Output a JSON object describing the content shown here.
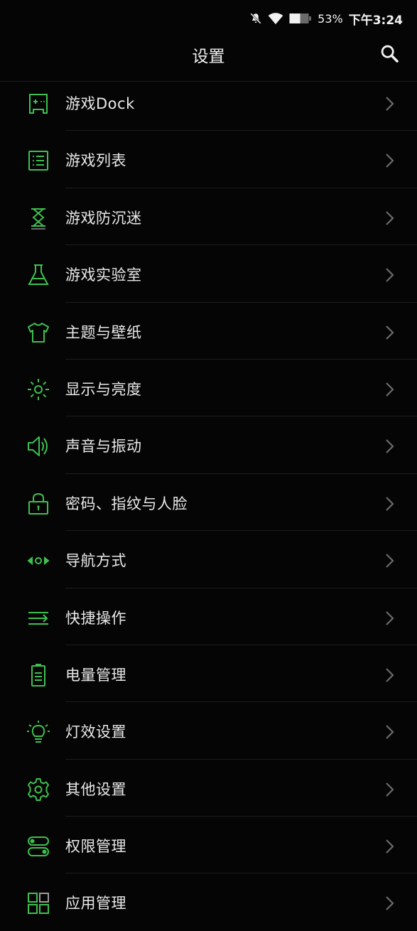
{
  "colors": {
    "accent": "#3fbf4f",
    "background": "#050505",
    "text": "#e9e9e9",
    "chevron": "#6b6b6b"
  },
  "status_bar": {
    "icons": [
      "bell-off-icon",
      "wifi-icon",
      "battery-icon"
    ],
    "battery_text": "53%",
    "time": "下午3:24"
  },
  "header": {
    "title": "设置",
    "search_icon": "search-icon"
  },
  "items": [
    {
      "label": "游戏Dock",
      "icon": "gamepad-icon"
    },
    {
      "label": "游戏列表",
      "icon": "list-icon"
    },
    {
      "label": "游戏防沉迷",
      "icon": "hourglass-icon"
    },
    {
      "label": "游戏实验室",
      "icon": "flask-icon"
    },
    {
      "label": "主题与壁纸",
      "icon": "shirt-icon"
    },
    {
      "label": "显示与亮度",
      "icon": "brightness-icon"
    },
    {
      "label": "声音与振动",
      "icon": "speaker-icon"
    },
    {
      "label": "密码、指纹与人脸",
      "icon": "lock-icon"
    },
    {
      "label": "导航方式",
      "icon": "navigation-icon"
    },
    {
      "label": "快捷操作",
      "icon": "shortcut-icon"
    },
    {
      "label": "电量管理",
      "icon": "battery-manage-icon"
    },
    {
      "label": "灯效设置",
      "icon": "bulb-icon"
    },
    {
      "label": "其他设置",
      "icon": "gear-icon"
    },
    {
      "label": "权限管理",
      "icon": "toggle-icon"
    },
    {
      "label": "应用管理",
      "icon": "apps-icon"
    }
  ]
}
